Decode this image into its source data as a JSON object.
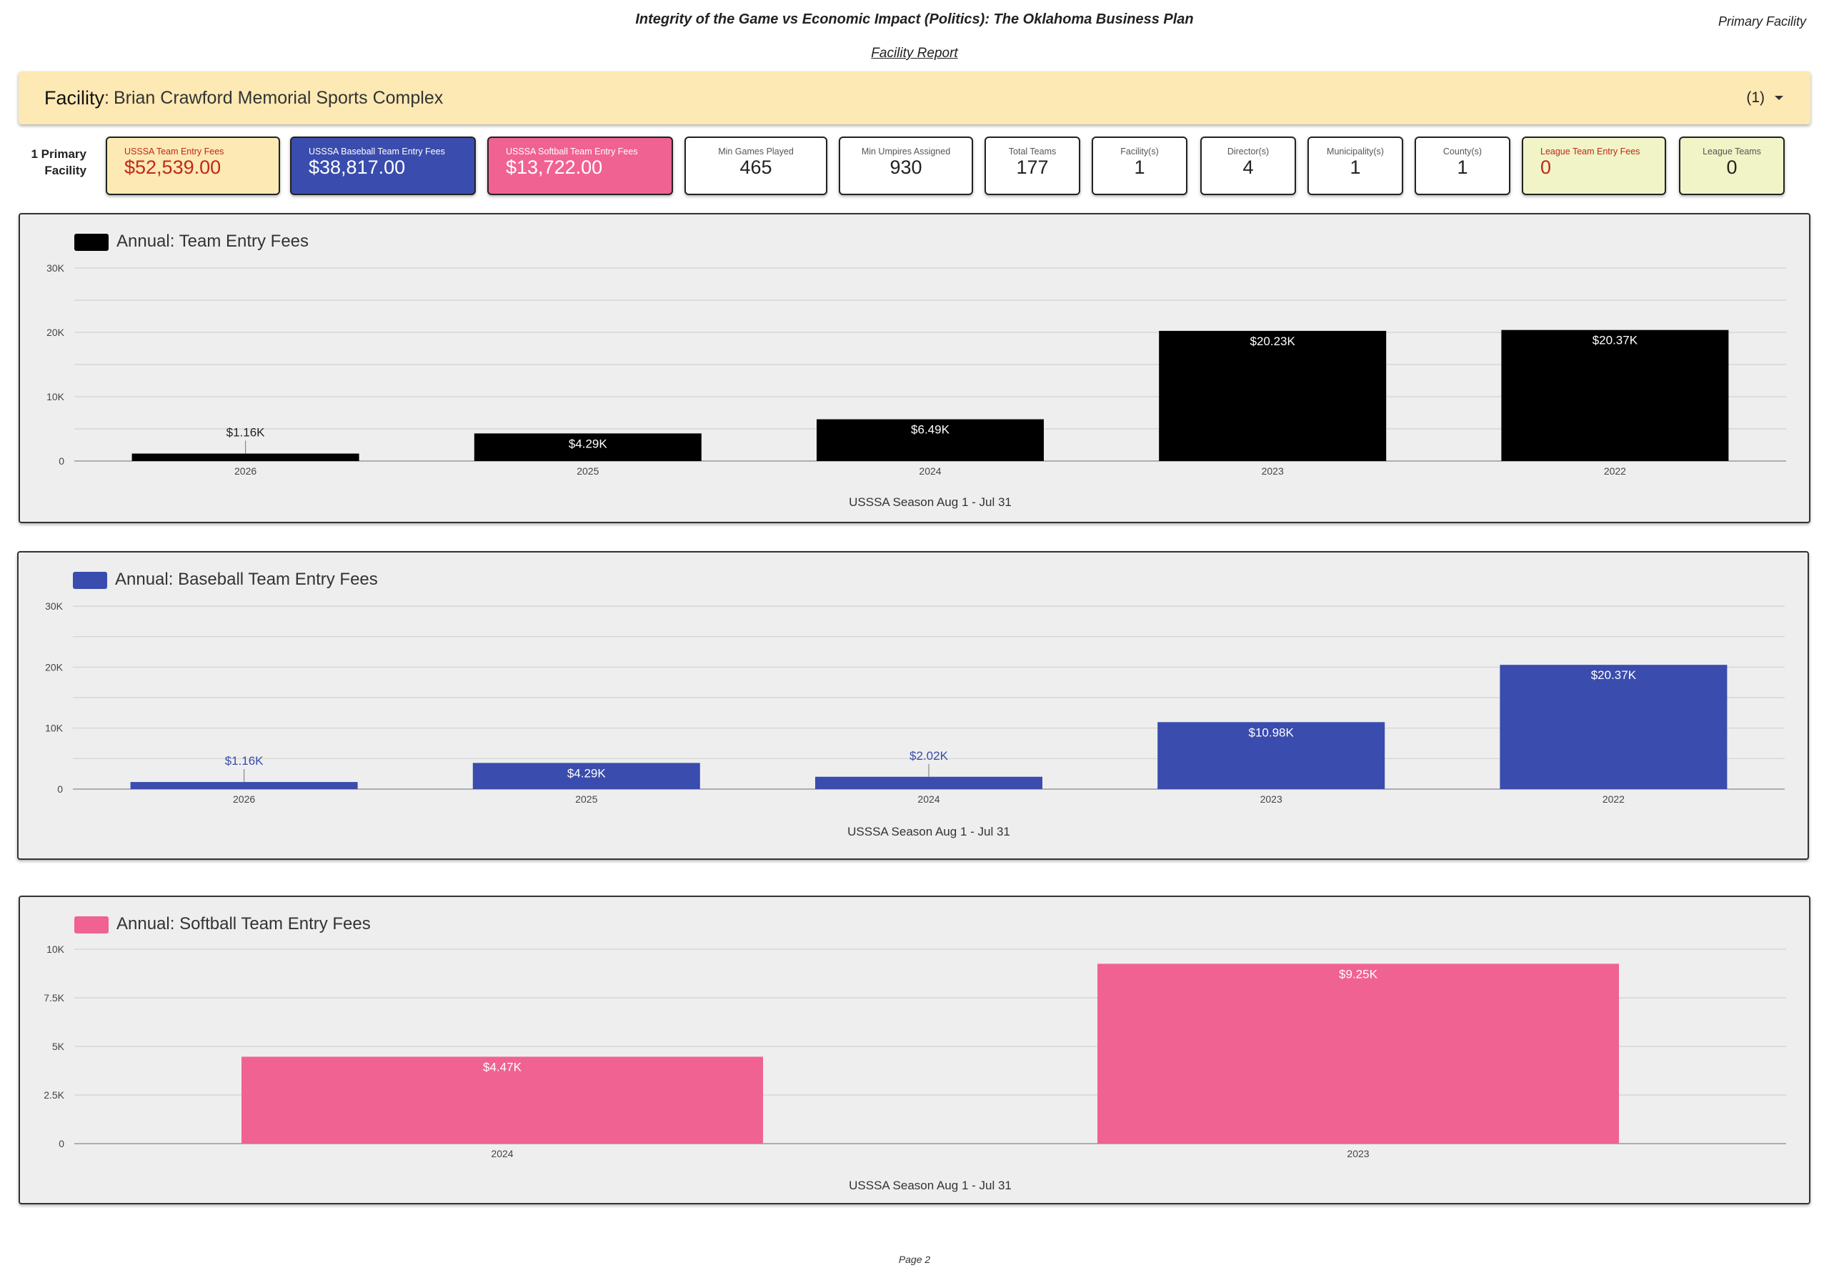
{
  "header": {
    "title": "Integrity of the Game vs Economic Impact (Politics): The Oklahoma Business Plan",
    "tag": "Primary Facility",
    "report_link": "Facility Report"
  },
  "facility_bar": {
    "key": "Facility",
    "separator": ":",
    "value": "Brian Crawford Memorial Sports Complex",
    "dropdown": "(1)",
    "background": "#fde9b3"
  },
  "primary_label": {
    "line1": "1 Primary",
    "line2": "Facility"
  },
  "kpis": [
    {
      "label": "USSSA Team Entry Fees",
      "value": "$52,539.00"
    },
    {
      "label": "USSSA Baseball Team Entry Fees",
      "value": "$38,817.00"
    },
    {
      "label": "USSSA Softball Team Entry Fees",
      "value": "$13,722.00"
    },
    {
      "label": "Min Games Played",
      "value": "465"
    },
    {
      "label": "Min Umpires Assigned",
      "value": "930"
    },
    {
      "label": "Total Teams",
      "value": "177"
    },
    {
      "label": "Facility(s)",
      "value": "1"
    },
    {
      "label": "Director(s)",
      "value": "4"
    },
    {
      "label": "Municipality(s)",
      "value": "1"
    },
    {
      "label": "County(s)",
      "value": "1"
    },
    {
      "label": "League Team Entry Fees",
      "value": "0"
    },
    {
      "label": "League Teams",
      "value": "0"
    }
  ],
  "colors": {
    "team_fees": "#000000",
    "baseball": "#3a4cad",
    "softball": "#f06292",
    "alert_text": "#c0281c"
  },
  "chart_data": [
    {
      "type": "bar",
      "legend": "Annual: Team Entry Fees",
      "categories": [
        "2026",
        "2025",
        "2024",
        "2023",
        "2022"
      ],
      "values": [
        1160,
        4290,
        6490,
        20230,
        20370
      ],
      "data_labels": [
        "$1.16K",
        "$4.29K",
        "$6.49K",
        "$20.23K",
        "$20.37K"
      ],
      "xlabel": "USSSA Season Aug 1 - Jul 31",
      "ylabel": "",
      "ylim": [
        0,
        30000
      ],
      "yticks": [
        0,
        10000,
        20000,
        30000
      ],
      "ytick_labels": [
        "0",
        "10K",
        "20K",
        "30K"
      ],
      "grid": true,
      "legend_placement": "top-left",
      "color": "#000000"
    },
    {
      "type": "bar",
      "legend": "Annual: Baseball Team Entry Fees",
      "categories": [
        "2026",
        "2025",
        "2024",
        "2023",
        "2022"
      ],
      "values": [
        1160,
        4290,
        2020,
        10980,
        20370
      ],
      "data_labels": [
        "$1.16K",
        "$4.29K",
        "$2.02K",
        "$10.98K",
        "$20.37K"
      ],
      "xlabel": "USSSA Season Aug 1 - Jul 31",
      "ylabel": "",
      "ylim": [
        0,
        30000
      ],
      "yticks": [
        0,
        10000,
        20000,
        30000
      ],
      "ytick_labels": [
        "0",
        "10K",
        "20K",
        "30K"
      ],
      "grid": true,
      "legend_placement": "top-left",
      "color": "#3a4cad"
    },
    {
      "type": "bar",
      "legend": "Annual: Softball Team Entry Fees",
      "categories": [
        "2024",
        "2023"
      ],
      "values": [
        4470,
        9250
      ],
      "data_labels": [
        "$4.47K",
        "$9.25K"
      ],
      "xlabel": "USSSA Season Aug 1 - Jul 31",
      "ylabel": "",
      "ylim": [
        0,
        10000
      ],
      "yticks": [
        0,
        2500,
        5000,
        7500,
        10000
      ],
      "ytick_labels": [
        "0",
        "2.5K",
        "5K",
        "7.5K",
        "10K"
      ],
      "grid": true,
      "legend_placement": "top-left",
      "color": "#f06292"
    }
  ],
  "footer": {
    "page": "Page 2"
  }
}
